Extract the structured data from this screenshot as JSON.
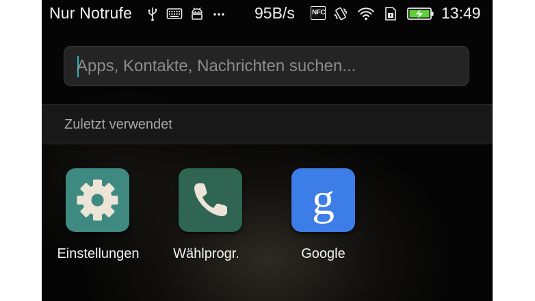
{
  "status_bar": {
    "carrier": "Nur Notrufe",
    "net_speed": "95B/s",
    "nfc_label": "NFC",
    "time": "13:49",
    "icons": [
      "usb-icon",
      "keyboard-icon",
      "android-icon",
      "more-dots-icon",
      "nfc-icon",
      "vibrate-icon",
      "wifi-icon",
      "sim-icon",
      "battery-charging-icon"
    ]
  },
  "search": {
    "placeholder": "Apps, Kontakte, Nachrichten suchen...",
    "value": ""
  },
  "recent_section": {
    "title": "Zuletzt verwendet"
  },
  "apps": [
    {
      "label": "Einstellungen",
      "icon": "gear-icon",
      "color": "#3f8a80"
    },
    {
      "label": "Wählprogr.",
      "icon": "phone-icon",
      "color": "#2f6552"
    },
    {
      "label": "Google",
      "icon": "google-g-icon",
      "color": "#3d7de8"
    }
  ],
  "colors": {
    "accent_caret": "#26b3c5",
    "battery_fill": "#5fcf3a"
  }
}
